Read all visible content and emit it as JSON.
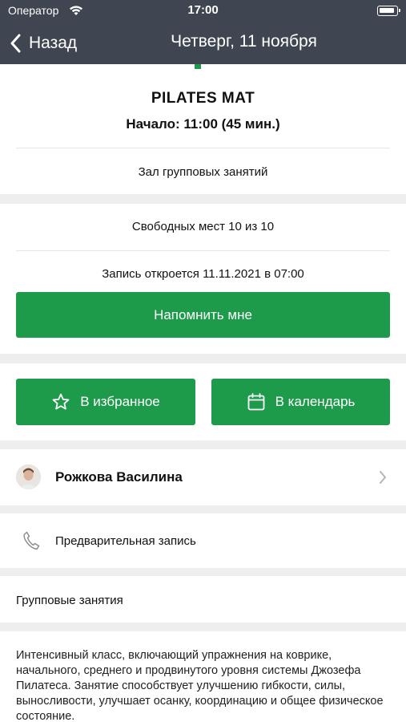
{
  "status_bar": {
    "carrier": "Оператор",
    "time": "17:00"
  },
  "nav": {
    "back_label": "Назад",
    "title": "Четверг, 11 ноября"
  },
  "session": {
    "name": "PILATES MAT",
    "start": "Начало: 11:00 (45 мин.)",
    "hall": "Зал групповых занятий"
  },
  "availability": {
    "spots": "Свободных мест 10 из 10",
    "opens": "Запись откроется 11.11.2021 в 07:00",
    "remind_label": "Напомнить мне"
  },
  "actions": {
    "favorite_label": "В избранное",
    "calendar_label": "В календарь"
  },
  "trainer": {
    "name": "Рожкова Василина"
  },
  "booking": {
    "label": "Предварительная запись"
  },
  "category": {
    "label": "Групповые занятия"
  },
  "description": "Интенсивный класс, включающий упражнения на коврике, начального, среднего и продвинутого уровня системы Джозефа Пилатеса. Занятие способствует улучшению гибкости, силы, выносливости, улучшает осанку, координацию и общее физическое состояние.",
  "colors": {
    "header": "#3f4651",
    "accent": "#1e9a4b",
    "separator": "#eeeeee"
  },
  "icons": [
    "wifi-icon",
    "battery-icon",
    "back-chevron-icon",
    "star-icon",
    "calendar-icon",
    "chevron-right-icon",
    "phone-icon"
  ]
}
